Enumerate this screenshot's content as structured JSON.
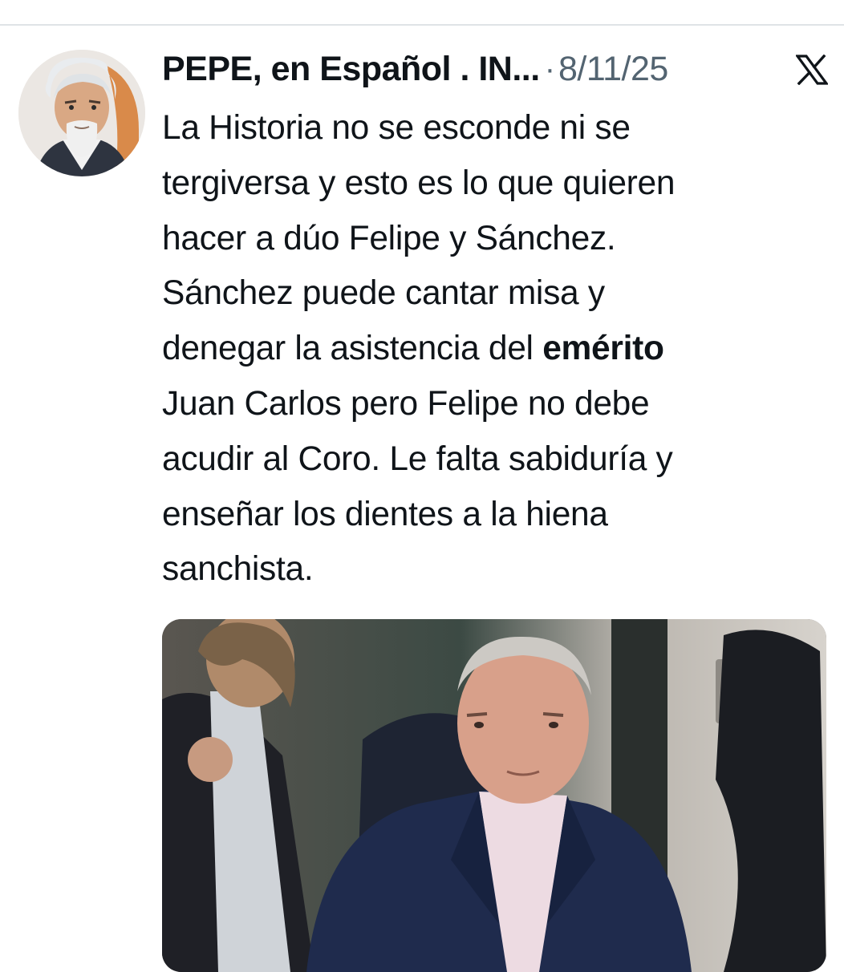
{
  "tweet": {
    "author": {
      "display_name": "PEPE, en Español . IN...",
      "avatar_icon": "bearded-man-avatar"
    },
    "separator": "·",
    "timestamp": "8/11/25",
    "platform_icon": "x-logo-icon",
    "text_lines": [
      {
        "text": "La Historia no se esconde ni se"
      },
      {
        "text": "tergiversa y esto es lo que quieren"
      },
      {
        "text": "hacer a dúo Felipe y Sánchez."
      },
      {
        "text": "Sánchez puede cantar misa y"
      },
      {
        "before": "denegar la asistencia del ",
        "bold": "emérito"
      },
      {
        "text": "Juan Carlos pero Felipe no debe"
      },
      {
        "text": "acudir al Coro. Le falta sabiduría y"
      },
      {
        "text": "enseñar los  dientes a la hiena"
      },
      {
        "text": "sanchista."
      }
    ],
    "media": {
      "kind": "photo",
      "icon": "photo-elderly-man-suit"
    }
  },
  "colors": {
    "text_primary": "#0f1419",
    "text_secondary": "#536471",
    "divider": "#dfe3e6"
  }
}
